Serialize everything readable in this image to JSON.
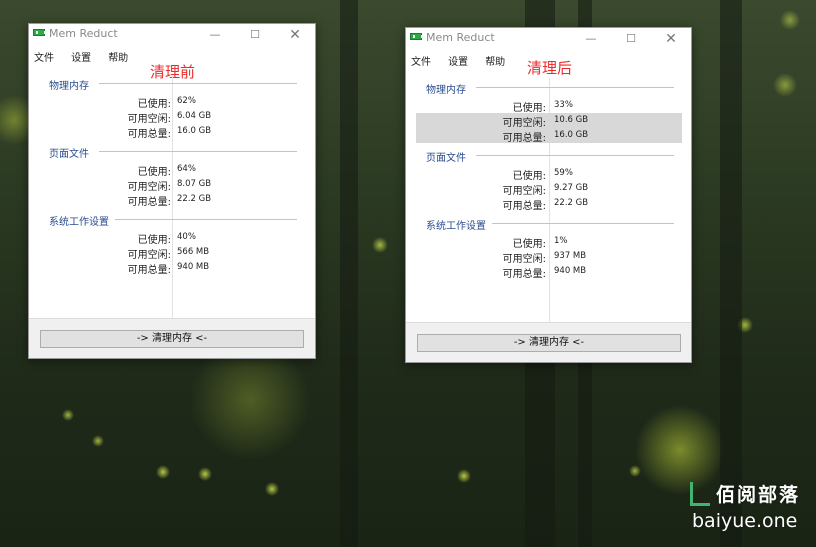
{
  "windows": [
    {
      "title": "Mem Reduct",
      "annotation": "清理前",
      "menu": [
        "文件",
        "设置",
        "帮助"
      ],
      "groups": [
        {
          "name": "物理内存",
          "rows": [
            {
              "label": "已使用:",
              "value": "62%"
            },
            {
              "label": "可用空闲:",
              "value": "6.04 GB"
            },
            {
              "label": "可用总量:",
              "value": "16.0 GB"
            }
          ]
        },
        {
          "name": "页面文件",
          "rows": [
            {
              "label": "已使用:",
              "value": "64%"
            },
            {
              "label": "可用空闲:",
              "value": "8.07 GB"
            },
            {
              "label": "可用总量:",
              "value": "22.2 GB"
            }
          ]
        },
        {
          "name": "系统工作设置",
          "rows": [
            {
              "label": "已使用:",
              "value": "40%"
            },
            {
              "label": "可用空闲:",
              "value": "566 MB"
            },
            {
              "label": "可用总量:",
              "value": "940 MB"
            }
          ]
        }
      ],
      "button": "-> 清理内存 <-"
    },
    {
      "title": "Mem Reduct",
      "annotation": "清理后",
      "menu": [
        "文件",
        "设置",
        "帮助"
      ],
      "groups": [
        {
          "name": "物理内存",
          "rows": [
            {
              "label": "已使用:",
              "value": "33%"
            },
            {
              "label": "可用空闲:",
              "value": "10.6 GB"
            },
            {
              "label": "可用总量:",
              "value": "16.0 GB"
            }
          ]
        },
        {
          "name": "页面文件",
          "rows": [
            {
              "label": "已使用:",
              "value": "59%"
            },
            {
              "label": "可用空闲:",
              "value": "9.27 GB"
            },
            {
              "label": "可用总量:",
              "value": "22.2 GB"
            }
          ]
        },
        {
          "name": "系统工作设置",
          "rows": [
            {
              "label": "已使用:",
              "value": "1%"
            },
            {
              "label": "可用空闲:",
              "value": "937 MB"
            },
            {
              "label": "可用总量:",
              "value": "940 MB"
            }
          ]
        }
      ],
      "button": "-> 清理内存 <-"
    }
  ],
  "watermark": {
    "cn": "佰阅部落",
    "en": "baiyue.one"
  },
  "colors": {
    "annotation": "#ee2b2b",
    "group_heading": "#2a4c8f",
    "app_icon": "#2fa84a",
    "row_highlight": "#d8d8d8"
  }
}
